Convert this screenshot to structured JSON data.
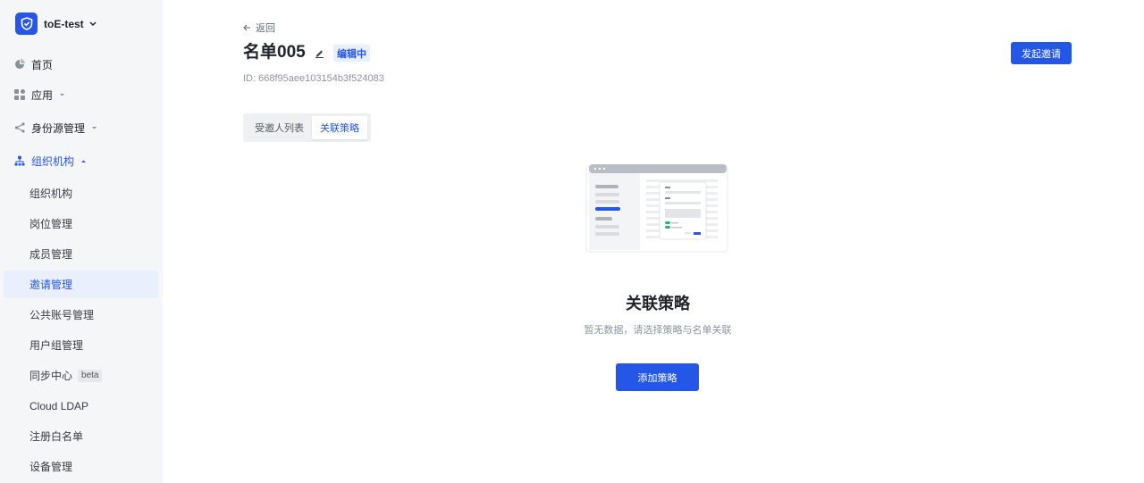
{
  "sidebar": {
    "tenant_name": "toE-test",
    "nav": [
      {
        "label": "首页",
        "icon": "pie-chart-icon"
      },
      {
        "label": "应用",
        "icon": "apps-grid-icon"
      },
      {
        "label": "身份源管理",
        "icon": "share-icon"
      },
      {
        "label": "组织机构",
        "icon": "org-tree-icon"
      }
    ],
    "sub_items": [
      {
        "label": "组织机构"
      },
      {
        "label": "岗位管理"
      },
      {
        "label": "成员管理"
      },
      {
        "label": "邀请管理"
      },
      {
        "label": "公共账号管理"
      },
      {
        "label": "用户组管理"
      },
      {
        "label": "同步中心",
        "tag": "beta"
      },
      {
        "label": "Cloud LDAP"
      },
      {
        "label": "注册白名单"
      },
      {
        "label": "设备管理"
      }
    ]
  },
  "header": {
    "back_label": "返回",
    "title": "名单005",
    "status": "编辑中",
    "id_line": "ID: 668f95aee103154b3f524083",
    "invite_button": "发起邀请"
  },
  "tabs": [
    {
      "label": "受邀人列表",
      "active": false
    },
    {
      "label": "关联策略",
      "active": true
    }
  ],
  "empty_state": {
    "title": "关联策略",
    "description": "暂无数据，请选择策略与名单关联",
    "action": "添加策略"
  },
  "colors": {
    "accent": "#2457e6",
    "sidebar_bg": "#f5f6f8",
    "selected_bg": "#e9effd"
  }
}
